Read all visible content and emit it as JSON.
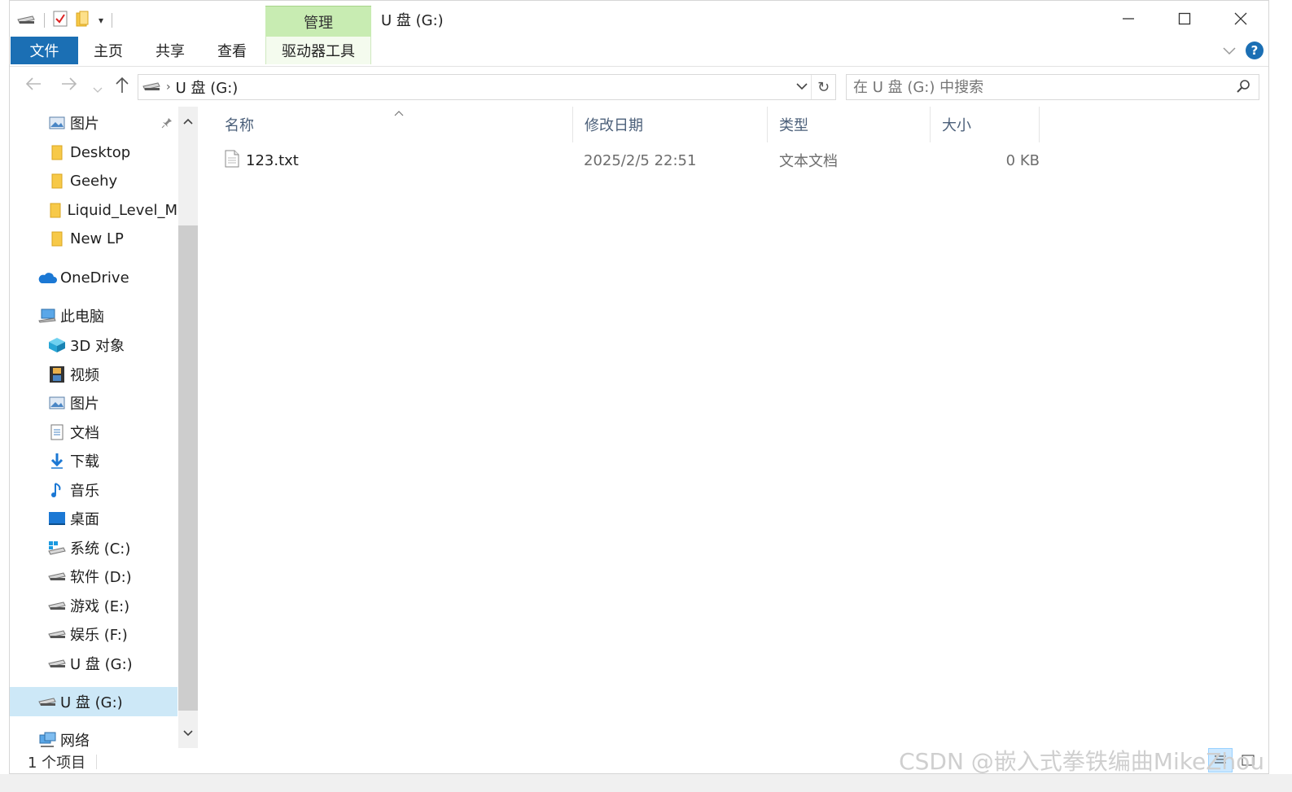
{
  "window": {
    "title": "U 盘 (G:)",
    "minimize_icon": "minimize-icon",
    "maximize_icon": "maximize-icon",
    "close_icon": "close-icon"
  },
  "ribbon": {
    "context_group": "管理",
    "tabs": [
      "文件",
      "主页",
      "共享",
      "查看",
      "驱动器工具"
    ],
    "help_label": "?"
  },
  "address": {
    "path": "U 盘 (G:)",
    "search_placeholder": "在 U 盘 (G:) 中搜索"
  },
  "navpane": {
    "quick_access": [
      "图片",
      "Desktop",
      "Geehy",
      "Liquid_Level_M",
      "New LP"
    ],
    "onedrive": "OneDrive",
    "this_pc": "此电脑",
    "pc_items": [
      "3D 对象",
      "视频",
      "图片",
      "文档",
      "下载",
      "音乐",
      "桌面",
      "系统 (C:)",
      "软件 (D:)",
      "游戏 (E:)",
      "娱乐 (F:)",
      "U 盘 (G:)"
    ],
    "selected_drive": "U 盘 (G:)",
    "network": "网络"
  },
  "list": {
    "columns": [
      "名称",
      "修改日期",
      "类型",
      "大小"
    ],
    "rows": [
      {
        "name": "123.txt",
        "modified": "2025/2/5 22:51",
        "type": "文本文档",
        "size": "0 KB"
      }
    ]
  },
  "status": {
    "count": "1 个项目"
  },
  "watermark": "CSDN @嵌入式拳铁编曲MikeZhou",
  "colors": {
    "file_tab": "#1b6fb4",
    "context_tab": "#c8ecb2",
    "selected_bg": "#cde8f7"
  }
}
